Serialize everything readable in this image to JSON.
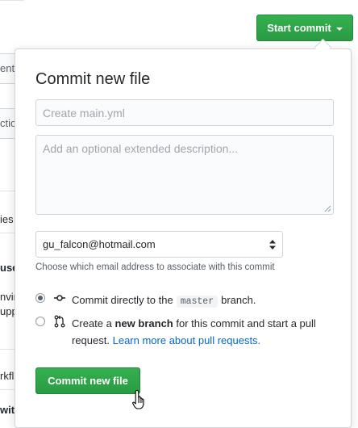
{
  "header": {
    "start_commit_label": "Start commit"
  },
  "background": {
    "fragments": [
      "enta",
      "ctio",
      "ies",
      "use",
      "nvir",
      "upp",
      "rkfl",
      "wit  ctions"
    ]
  },
  "popover": {
    "title": "Commit new file",
    "summary_placeholder": "Create main.yml",
    "description_placeholder": "Add an optional extended description...",
    "email_value": "gu_falcon@hotmail.com",
    "email_hint": "Choose which email address to associate with this commit",
    "option_direct": {
      "prefix": "Commit directly to the",
      "branch": "master",
      "suffix": "branch.",
      "checked": true
    },
    "option_new_branch": {
      "prefix": "Create a",
      "bold": "new branch",
      "middle": "for this commit and start a pull request.",
      "link": "Learn more about pull requests.",
      "checked": false
    },
    "commit_button_label": "Commit new file"
  },
  "colors": {
    "primary_green": "#2ea44f",
    "link_blue": "#0366d6",
    "border": "#d1d5da"
  },
  "icons": [
    "caret-down-icon",
    "commit-icon",
    "pull-request-icon",
    "select-updown-icon",
    "hand-pointer-cursor"
  ]
}
